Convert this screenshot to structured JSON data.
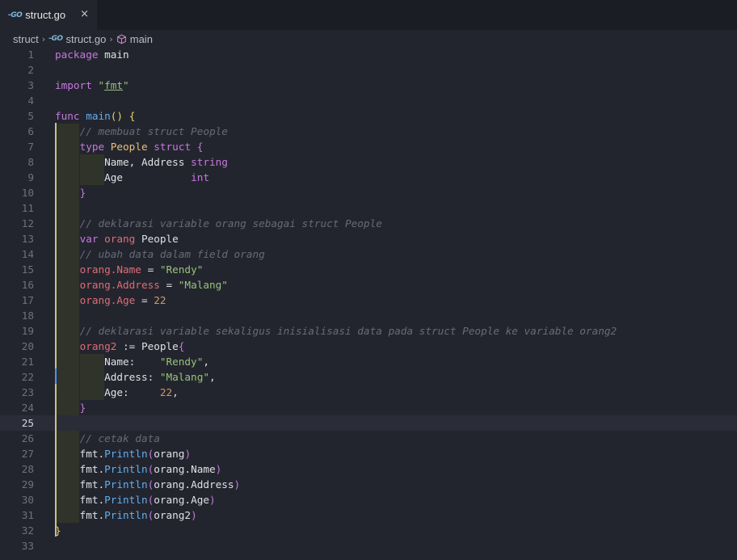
{
  "tab": {
    "icon": "go-file-icon",
    "title": "struct.go",
    "close": "×"
  },
  "breadcrumb": {
    "folder": "struct",
    "file": "struct.go",
    "symbol": "main"
  },
  "current_line": 25,
  "lines": [
    {
      "n": "1",
      "guides": 0,
      "tokens": [
        [
          "kw",
          "package"
        ],
        [
          "pl",
          " main"
        ]
      ]
    },
    {
      "n": "2",
      "guides": 0,
      "tokens": []
    },
    {
      "n": "3",
      "guides": 0,
      "tokens": [
        [
          "kw",
          "import"
        ],
        [
          "pl",
          " "
        ],
        [
          "str",
          "\""
        ],
        [
          "stru",
          "fmt"
        ],
        [
          "str",
          "\""
        ]
      ]
    },
    {
      "n": "4",
      "guides": 0,
      "tokens": []
    },
    {
      "n": "5",
      "guides": 0,
      "tokens": [
        [
          "kw",
          "func"
        ],
        [
          "pl",
          " "
        ],
        [
          "fn",
          "main"
        ],
        [
          "br",
          "()"
        ],
        [
          "pl",
          " "
        ],
        [
          "br",
          "{"
        ]
      ]
    },
    {
      "n": "6",
      "guides": 1,
      "tokens": [
        [
          "pl",
          "    "
        ],
        [
          "cm",
          "// membuat struct People"
        ]
      ]
    },
    {
      "n": "7",
      "guides": 1,
      "tokens": [
        [
          "pl",
          "    "
        ],
        [
          "kw",
          "type"
        ],
        [
          "pl",
          " "
        ],
        [
          "ty",
          "People"
        ],
        [
          "pl",
          " "
        ],
        [
          "kw",
          "struct"
        ],
        [
          "pl",
          " "
        ],
        [
          "mb",
          "{"
        ]
      ]
    },
    {
      "n": "8",
      "guides": 2,
      "tokens": [
        [
          "pl",
          "        Name, Address "
        ],
        [
          "kw",
          "string"
        ]
      ]
    },
    {
      "n": "9",
      "guides": 2,
      "tokens": [
        [
          "pl",
          "        Age           "
        ],
        [
          "kw",
          "int"
        ]
      ]
    },
    {
      "n": "10",
      "guides": 1,
      "tokens": [
        [
          "pl",
          "    "
        ],
        [
          "mb",
          "}"
        ]
      ]
    },
    {
      "n": "11",
      "guides": 1,
      "tokens": []
    },
    {
      "n": "12",
      "guides": 1,
      "tokens": [
        [
          "pl",
          "    "
        ],
        [
          "cm",
          "// deklarasi variable orang sebagai struct People"
        ]
      ]
    },
    {
      "n": "13",
      "guides": 1,
      "tokens": [
        [
          "pl",
          "    "
        ],
        [
          "kw",
          "var"
        ],
        [
          "pl",
          " "
        ],
        [
          "var",
          "orang"
        ],
        [
          "pl",
          " People"
        ]
      ]
    },
    {
      "n": "14",
      "guides": 1,
      "tokens": [
        [
          "pl",
          "    "
        ],
        [
          "cm",
          "// ubah data dalam field orang"
        ]
      ]
    },
    {
      "n": "15",
      "guides": 1,
      "tokens": [
        [
          "pl",
          "    "
        ],
        [
          "var",
          "orang.Name"
        ],
        [
          "pl",
          " = "
        ],
        [
          "str",
          "\"Rendy\""
        ]
      ]
    },
    {
      "n": "16",
      "guides": 1,
      "tokens": [
        [
          "pl",
          "    "
        ],
        [
          "var",
          "orang.Address"
        ],
        [
          "pl",
          " = "
        ],
        [
          "str",
          "\"Malang\""
        ]
      ]
    },
    {
      "n": "17",
      "guides": 1,
      "tokens": [
        [
          "pl",
          "    "
        ],
        [
          "var",
          "orang.Age"
        ],
        [
          "pl",
          " = "
        ],
        [
          "num",
          "22"
        ]
      ]
    },
    {
      "n": "18",
      "guides": 1,
      "tokens": []
    },
    {
      "n": "19",
      "guides": 1,
      "tokens": [
        [
          "pl",
          "    "
        ],
        [
          "cm",
          "// deklarasi variable sekaligus inisialisasi data pada struct People ke variable orang2"
        ]
      ]
    },
    {
      "n": "20",
      "guides": 1,
      "tokens": [
        [
          "pl",
          "    "
        ],
        [
          "var",
          "orang2"
        ],
        [
          "pl",
          " := People"
        ],
        [
          "mb",
          "{"
        ]
      ]
    },
    {
      "n": "21",
      "guides": 2,
      "tokens": [
        [
          "pl",
          "        Name:    "
        ],
        [
          "str",
          "\"Rendy\""
        ],
        [
          "pl",
          ","
        ]
      ]
    },
    {
      "n": "22",
      "guides": 2,
      "tokens": [
        [
          "pl",
          "        Address: "
        ],
        [
          "str",
          "\"Malang\""
        ],
        [
          "pl",
          ","
        ]
      ]
    },
    {
      "n": "23",
      "guides": 2,
      "tokens": [
        [
          "pl",
          "        Age:     "
        ],
        [
          "num",
          "22"
        ],
        [
          "pl",
          ","
        ]
      ]
    },
    {
      "n": "24",
      "guides": 1,
      "tokens": [
        [
          "pl",
          "    "
        ],
        [
          "mb",
          "}"
        ]
      ]
    },
    {
      "n": "25",
      "guides": 0,
      "tokens": []
    },
    {
      "n": "26",
      "guides": 1,
      "tokens": [
        [
          "pl",
          "    "
        ],
        [
          "cm",
          "// cetak data"
        ]
      ]
    },
    {
      "n": "27",
      "guides": 1,
      "tokens": [
        [
          "pl",
          "    fmt."
        ],
        [
          "fn",
          "Println"
        ],
        [
          "mb",
          "("
        ],
        [
          "pl",
          "orang"
        ],
        [
          "mb",
          ")"
        ]
      ]
    },
    {
      "n": "28",
      "guides": 1,
      "tokens": [
        [
          "pl",
          "    fmt."
        ],
        [
          "fn",
          "Println"
        ],
        [
          "mb",
          "("
        ],
        [
          "pl",
          "orang.Name"
        ],
        [
          "mb",
          ")"
        ]
      ]
    },
    {
      "n": "29",
      "guides": 1,
      "tokens": [
        [
          "pl",
          "    fmt."
        ],
        [
          "fn",
          "Println"
        ],
        [
          "mb",
          "("
        ],
        [
          "pl",
          "orang.Address"
        ],
        [
          "mb",
          ")"
        ]
      ]
    },
    {
      "n": "30",
      "guides": 1,
      "tokens": [
        [
          "pl",
          "    fmt."
        ],
        [
          "fn",
          "Println"
        ],
        [
          "mb",
          "("
        ],
        [
          "pl",
          "orang.Age"
        ],
        [
          "mb",
          ")"
        ]
      ]
    },
    {
      "n": "31",
      "guides": 1,
      "tokens": [
        [
          "pl",
          "    fmt."
        ],
        [
          "fn",
          "Println"
        ],
        [
          "mb",
          "("
        ],
        [
          "pl",
          "orang2"
        ],
        [
          "mb",
          ")"
        ]
      ]
    },
    {
      "n": "32",
      "guides": 0,
      "tokens": [
        [
          "br",
          "}"
        ]
      ]
    },
    {
      "n": "33",
      "guides": 0,
      "tokens": []
    }
  ]
}
